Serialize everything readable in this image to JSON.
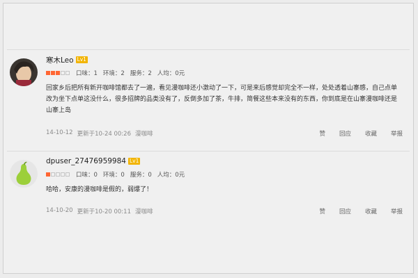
{
  "reviews": [
    {
      "username": "寒木Leo",
      "level": "Lv1",
      "rating": 3,
      "scores": {
        "taste": "口味：1",
        "environment": "环境：2",
        "service": "服务：2",
        "avg_price": "人均：0元"
      },
      "body": "回家乡后把所有新开咖啡馆都去了一遍，看见漫咖啡还小激动了一下，可是来后感觉却完全不一样，处处透着山寨感，自己点单改为坐下点单这没什么，很多招牌的品类没有了，反倒多加了茶，牛排，简餐这些本来没有的东西，你到底是在山寨漫咖啡还是山寨上岛",
      "date": "14-10-12",
      "updated": "更新于10-24 00:26",
      "shop": "漫咖啡",
      "actions": {
        "like": "赞",
        "reply": "回应",
        "favorite": "收藏",
        "report": "举报"
      }
    },
    {
      "username": "dpuser_27476959984",
      "level": "Lv1",
      "rating": 1,
      "scores": {
        "taste": "口味：0",
        "environment": "环境：0",
        "service": "服务：0",
        "avg_price": "人均：0元"
      },
      "body": "哈哈，安康的漫咖啡是假的，弱爆了！",
      "date": "14-10-20",
      "updated": "更新于10-20 00:11",
      "shop": "漫咖啡",
      "actions": {
        "like": "赞",
        "reply": "回应",
        "favorite": "收藏",
        "report": "举报"
      }
    }
  ],
  "colors": {
    "star_on": "#ff6633",
    "level_badge": "#f2b400"
  },
  "icons": {
    "rating": "star-icon"
  }
}
